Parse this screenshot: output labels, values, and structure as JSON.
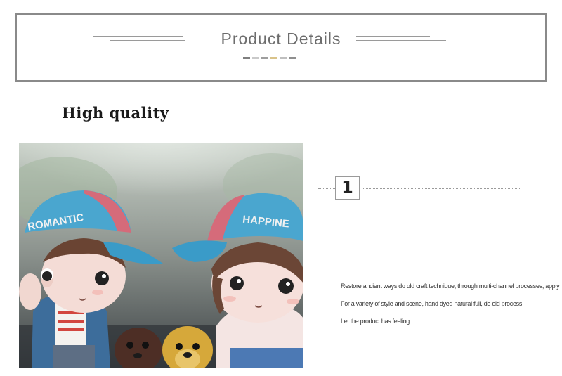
{
  "banner": {
    "title": "Product Details",
    "dot_colors": [
      "#7f7f7f",
      "#c9c9c9",
      "#9e9e9e",
      "#d9c38a",
      "#bfbfbf",
      "#8f8f8f"
    ]
  },
  "heading": "High quality",
  "photo": {
    "cap_left_text": "ROMANTIC",
    "cap_right_text": "HAPPINE"
  },
  "feature": {
    "number": "1",
    "lines": [
      "Restore ancient ways do old craft technique, through multi-channel processes, apply",
      "For a variety of style and scene, hand dyed natural full, do old process",
      "Let the product has feeling."
    ]
  }
}
